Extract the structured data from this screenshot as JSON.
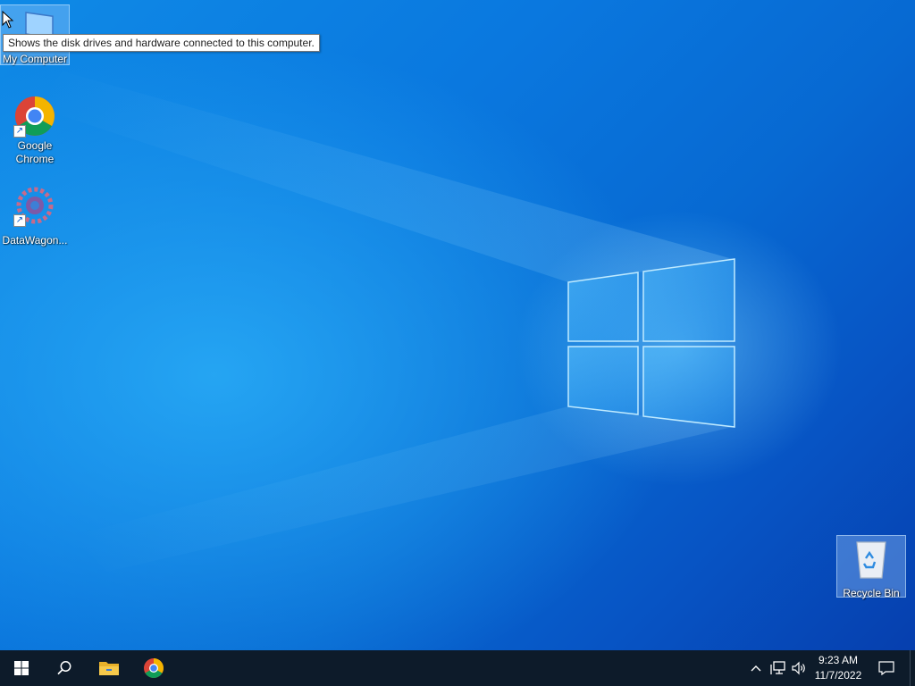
{
  "desktop": {
    "icons": [
      {
        "label": "My Computer"
      },
      {
        "label": "Google Chrome"
      },
      {
        "label": "DataWagon..."
      },
      {
        "label": "Recycle Bin"
      }
    ],
    "tooltip": "Shows the disk drives and hardware connected to this computer."
  },
  "taskbar": {
    "time": "9:23 AM",
    "date": "11/7/2022",
    "pinned": [
      "start-icon",
      "search-icon",
      "file-explorer-icon",
      "chrome-icon"
    ],
    "tray": [
      "chevron-up-icon",
      "network-icon",
      "volume-icon",
      "notifications-icon"
    ]
  },
  "colors": {
    "taskbar": "#0d1b2a",
    "wallpaper_primary": "#0a78df",
    "windows_logo": "#8fd6ff"
  }
}
